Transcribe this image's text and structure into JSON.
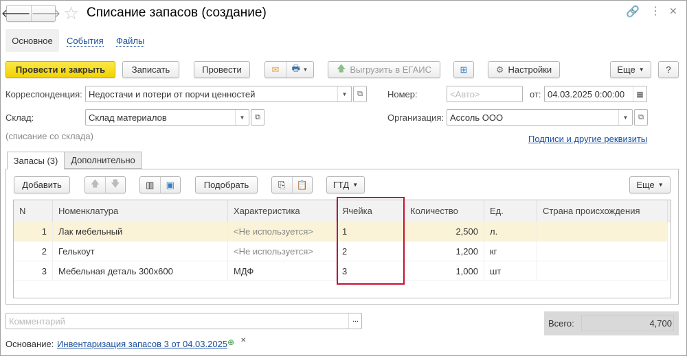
{
  "title": "Списание запасов (создание)",
  "nav_tabs": [
    {
      "label": "Основное"
    },
    {
      "label": "События"
    },
    {
      "label": "Файлы"
    }
  ],
  "toolbar": {
    "post_close": "Провести и закрыть",
    "save": "Записать",
    "post": "Провести",
    "egais": "Выгрузить в ЕГАИС",
    "settings": "Настройки",
    "more": "Еще",
    "help": "?"
  },
  "form": {
    "corr_label": "Корреспонденция:",
    "corr_value": "Недостачи и потери от порчи ценностей",
    "number_label": "Номер:",
    "number_placeholder": "<Авто>",
    "date_label": "от:",
    "date_value": "04.03.2025  0:00:00",
    "warehouse_label": "Склад:",
    "warehouse_value": "Склад материалов",
    "org_label": "Организация:",
    "org_value": "Ассоль ООО",
    "hint": "(списание со склада)",
    "signatures_link": "Подписи и другие реквизиты"
  },
  "tabs": [
    {
      "label": "Запасы (3)"
    },
    {
      "label": "Дополнительно"
    }
  ],
  "table_toolbar": {
    "add": "Добавить",
    "pick": "Подобрать",
    "gtd": "ГТД",
    "more": "Еще"
  },
  "table": {
    "columns": [
      "N",
      "Номенклатура",
      "Характеристика",
      "Ячейка",
      "Количество",
      "Ед.",
      "Страна происхождения"
    ],
    "rows": [
      {
        "n": "1",
        "item": "Лак мебельный",
        "char": "<Не используется>",
        "cell": "1",
        "qty": "2,500",
        "unit": "л.",
        "country": ""
      },
      {
        "n": "2",
        "item": "Гелькоут",
        "char": "<Не используется>",
        "cell": "2",
        "qty": "1,200",
        "unit": "кг",
        "country": ""
      },
      {
        "n": "3",
        "item": "Мебельная деталь 300х600",
        "char": "МДФ",
        "cell": "3",
        "qty": "1,000",
        "unit": "шт",
        "country": ""
      }
    ]
  },
  "comment_placeholder": "Комментарий",
  "total": {
    "label": "Всего:",
    "value": "4,700"
  },
  "basis": {
    "label": "Основание:",
    "link": "Инвентаризация запасов 3 от 04.03.2025"
  },
  "colors": {
    "accent": "#f5d800",
    "highlight": "#c8102e",
    "selected_row": "#faf3d7"
  }
}
